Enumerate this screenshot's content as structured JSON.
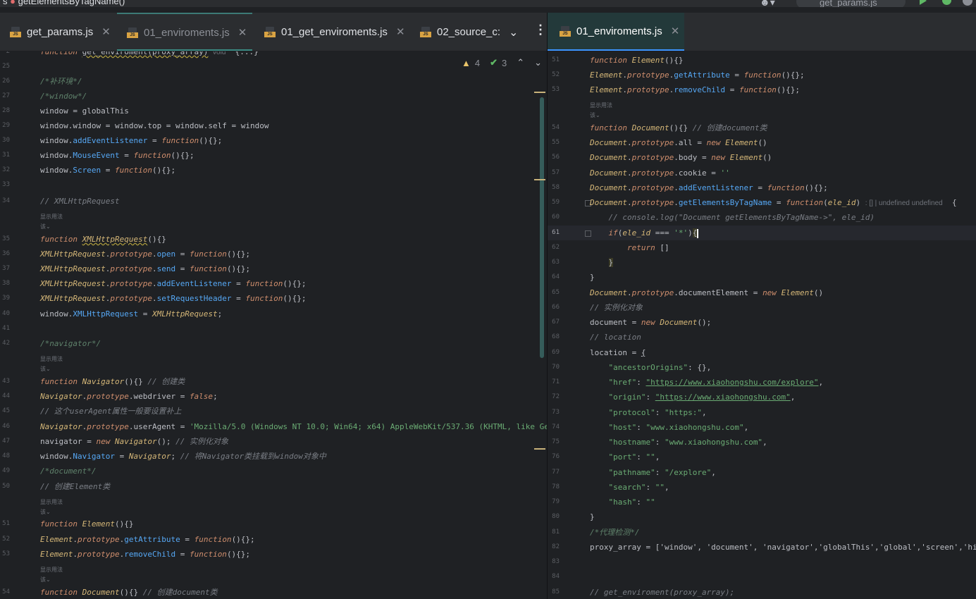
{
  "top_bar": {
    "breadcrumb": " getElementsByTagName()",
    "run_config": "get_params.js"
  },
  "left_tabs": [
    {
      "label": "get_params.js"
    },
    {
      "label": "01_enviroments.js"
    },
    {
      "label": "01_get_enviroments.js"
    },
    {
      "label": "02_source_c:"
    }
  ],
  "right_tabs": [
    {
      "label": "01_enviroments.js"
    }
  ],
  "file_icon_badge": "JS",
  "inspections": {
    "warnings": "4",
    "weak_warnings": "3"
  },
  "hints": {
    "usage": "显示用法",
    "usage_short": "该",
    "param_hint": ": [] | undefined"
  },
  "left_editor": {
    "line_numbers": [
      "2",
      "25",
      "26",
      "27",
      "28",
      "29",
      "30",
      "31",
      "32",
      "33",
      "34",
      "35",
      "36",
      "37",
      "38",
      "39",
      "40",
      "41",
      "42",
      "43",
      "44",
      "45",
      "46",
      "47",
      "48",
      "49",
      "50",
      "51",
      "52",
      "53",
      "54"
    ],
    "sticky": "function get_enviroment(proxy_array)  void  {...}",
    "comments": {
      "bu_env": "/*补环境*/",
      "window": "/*window*/",
      "xhr": "// XMLHttpRequest",
      "navigator": "/*navigator*/",
      "create_class": "// 创建类",
      "ua_note": "// 这个userAgent属性一般要设置补上",
      "instance": "// 实例化对象",
      "mount": "// 将Navigator类挂载到window对象中",
      "document": "/*document*/",
      "create_element": "// 创建Element类",
      "create_document": "// 创建document类"
    },
    "ua_string": "'Mozilla/5.0 (Windows NT 10.0; Win64; x64) AppleWebKit/537.36 (KHTML, like Gecko) Chrome"
  },
  "right_editor": {
    "line_numbers": [
      "51",
      "52",
      "53",
      "54",
      "55",
      "56",
      "57",
      "58",
      "59",
      "60",
      "61",
      "62",
      "63",
      "64",
      "65",
      "66",
      "67",
      "68",
      "69",
      "70",
      "71",
      "72",
      "73",
      "74",
      "75",
      "76",
      "77",
      "78",
      "79",
      "80",
      "81",
      "82",
      "83",
      "84",
      "85"
    ],
    "comments": {
      "create_document": "// 创建document类",
      "console_log": "// console.log(\"Document getElementsByTagName->\", ele_id)",
      "instance": "// 实例化对象",
      "location": "// location",
      "proxy": "/*代理检测*/",
      "get_env": "// get_enviroment(proxy_array);"
    },
    "location": [
      {
        "key": "\"ancestorOrigins\"",
        "value": "{}"
      },
      {
        "key": "\"href\"",
        "value": "\"https://www.xiaohongshu.com/explore\""
      },
      {
        "key": "\"origin\"",
        "value": "\"https://www.xiaohongshu.com\""
      },
      {
        "key": "\"protocol\"",
        "value": "\"https:\""
      },
      {
        "key": "\"host\"",
        "value": "\"www.xiaohongshu.com\""
      },
      {
        "key": "\"hostname\"",
        "value": "\"www.xiaohongshu.com\""
      },
      {
        "key": "\"port\"",
        "value": "\"\""
      },
      {
        "key": "\"pathname\"",
        "value": "\"/explore\""
      },
      {
        "key": "\"search\"",
        "value": "\"\""
      },
      {
        "key": "\"hash\"",
        "value": "\"\""
      }
    ],
    "proxy_array": "proxy_array = ['window', 'document', 'navigator','globalThis','global','screen','history','"
  },
  "colors": {
    "accent_tab": "#3c94ff",
    "keyword": "#cf8e6d",
    "class": "#d5b778",
    "string": "#6aab73",
    "comment": "#7a7e85"
  }
}
